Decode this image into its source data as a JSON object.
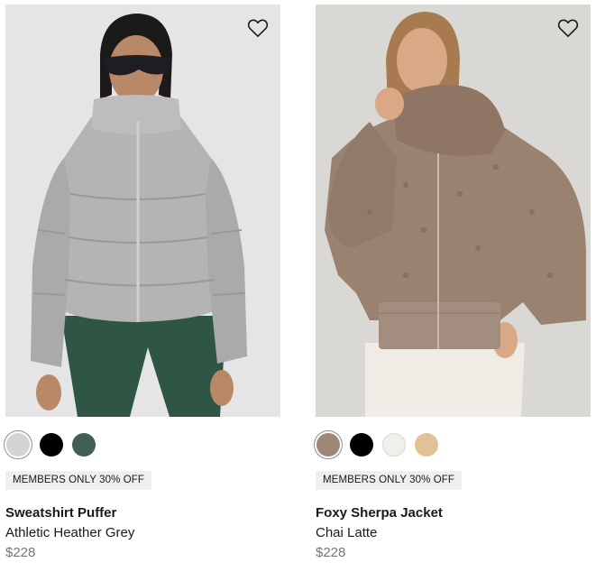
{
  "products": [
    {
      "name": "Sweatshirt Puffer",
      "color_name": "Athletic Heather Grey",
      "price": "$228",
      "badge": "MEMBERS ONLY 30% OFF",
      "wishlist_icon": "heart-outline-icon",
      "swatches": [
        "#d4d4d4",
        "#000000",
        "#425e55"
      ],
      "selected_swatch": 0
    },
    {
      "name": "Foxy Sherpa Jacket",
      "color_name": "Chai Latte",
      "price": "$228",
      "badge": "MEMBERS ONLY 30% OFF",
      "wishlist_icon": "heart-outline-icon",
      "swatches": [
        "#a08878",
        "#000000",
        "#f1efea",
        "#e2c196"
      ],
      "selected_swatch": 0
    }
  ]
}
